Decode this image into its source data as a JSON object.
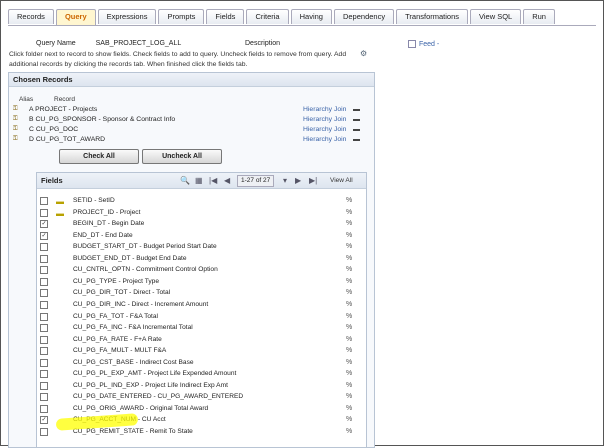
{
  "tabs": [
    "Records",
    "Query",
    "Expressions",
    "Prompts",
    "Fields",
    "Criteria",
    "Having",
    "Dependency",
    "Transformations",
    "View SQL",
    "Run"
  ],
  "active_tab": "Query",
  "query": {
    "name_label": "Query Name",
    "name_value": "SAB_PROJECT_LOG_ALL",
    "description_label": "Description",
    "feed_label": "Feed -"
  },
  "instructions": "Click folder next to record to show fields. Check fields to add to query. Uncheck fields to remove from query. Add additional records by clicking the records tab. When finished click the fields tab.",
  "chosen": {
    "title": "Chosen Records",
    "alias_header": "Alias",
    "record_header": "Record",
    "records": [
      {
        "alias": "A",
        "name": "PROJECT - Projects",
        "join": "Hierarchy Join"
      },
      {
        "alias": "B",
        "name": "CU_PG_SPONSOR - Sponsor & Contract Info",
        "join": "Hierarchy Join"
      },
      {
        "alias": "C",
        "name": "CU_PG_DOC",
        "join": "Hierarchy Join"
      },
      {
        "alias": "D",
        "name": "CU_PG_TOT_AWARD",
        "join": "Hierarchy Join"
      }
    ],
    "check_all": "Check All",
    "uncheck_all": "Uncheck All"
  },
  "fields": {
    "title": "Fields",
    "page_count": "1-27 of 27",
    "view_all": "View All",
    "rows": [
      {
        "label": "SETID - SetID",
        "checked": false,
        "folder": true
      },
      {
        "label": "PROJECT_ID - Project",
        "checked": false,
        "folder": true
      },
      {
        "label": "BEGIN_DT - Begin Date",
        "checked": true,
        "folder": false
      },
      {
        "label": "END_DT - End Date",
        "checked": true,
        "folder": false
      },
      {
        "label": "BUDGET_START_DT - Budget Period Start Date",
        "checked": false,
        "folder": false
      },
      {
        "label": "BUDGET_END_DT - Budget End Date",
        "checked": false,
        "folder": false
      },
      {
        "label": "CU_CNTRL_OPTN - Commitment Control Option",
        "checked": false,
        "folder": false
      },
      {
        "label": "CU_PG_TYPE - Project Type",
        "checked": false,
        "folder": false
      },
      {
        "label": "CU_PG_DIR_TOT - Direct - Total",
        "checked": false,
        "folder": false
      },
      {
        "label": "CU_PG_DIR_INC - Direct - Increment Amount",
        "checked": false,
        "folder": false
      },
      {
        "label": "CU_PG_FA_TOT - F&A Total",
        "checked": false,
        "folder": false
      },
      {
        "label": "CU_PG_FA_INC - F&A Incremental Total",
        "checked": false,
        "folder": false
      },
      {
        "label": "CU_PG_FA_RATE - F+A Rate",
        "checked": false,
        "folder": false
      },
      {
        "label": "CU_PG_FA_MULT - MULT F&A",
        "checked": false,
        "folder": false
      },
      {
        "label": "CU_PG_CST_BASE - Indirect Cost Base",
        "checked": false,
        "folder": false
      },
      {
        "label": "CU_PG_PL_EXP_AMT - Project Life Expended Amount",
        "checked": false,
        "folder": false
      },
      {
        "label": "CU_PG_PL_IND_EXP - Project Life Indirect Exp Amt",
        "checked": false,
        "folder": false
      },
      {
        "label": "CU_PG_DATE_ENTERED - CU_PG_AWARD_ENTERED",
        "checked": false,
        "folder": false
      },
      {
        "label": "CU_PG_ORIG_AWARD - Original Total Award",
        "checked": false,
        "folder": false
      },
      {
        "label": "CU_PG_ACCT_NUM - CU Acct",
        "checked": true,
        "folder": false
      },
      {
        "label": "CU_PG_REMIT_STATE - Remit To State",
        "checked": false,
        "folder": false
      }
    ]
  }
}
